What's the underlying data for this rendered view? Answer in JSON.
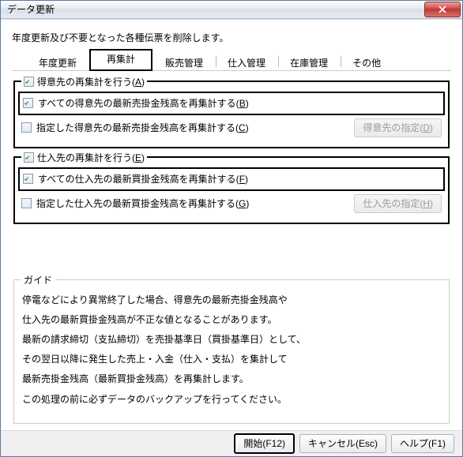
{
  "window": {
    "title": "データ更新"
  },
  "intro": "年度更新及び不要となった各種伝票を削除します。",
  "tabs": {
    "t0": "年度更新",
    "t1": "再集計",
    "t2": "販売管理",
    "t3": "仕入管理",
    "t4": "在庫管理",
    "t5": "その他"
  },
  "grp1": {
    "legend_pre": "得意先の再集計を行う(",
    "legend_u": "A",
    "legend_post": ")",
    "r1_pre": "すべての得意先の最新売掛金残高を再集計する(",
    "r1_u": "B",
    "r1_post": ")",
    "r2_pre": "指定した得意先の最新売掛金残高を再集計する(",
    "r2_u": "C",
    "r2_post": ")",
    "btn_pre": "得意先の指定(",
    "btn_u": "D",
    "btn_post": ")"
  },
  "grp2": {
    "legend_pre": "仕入先の再集計を行う(",
    "legend_u": "E",
    "legend_post": ")",
    "r1_pre": "すべての仕入先の最新買掛金残高を再集計する(",
    "r1_u": "F",
    "r1_post": ")",
    "r2_pre": "指定した仕入先の最新買掛金残高を再集計する(",
    "r2_u": "G",
    "r2_post": ")",
    "btn_pre": "仕入先の指定(",
    "btn_u": "H",
    "btn_post": ")"
  },
  "guide": {
    "title": "ガイド",
    "l1": "停電などにより異常終了した場合、得意先の最新売掛金残高や",
    "l2": "仕入先の最新買掛金残高が不正な値となることがあります。",
    "l3": "最新の請求締切（支払締切）を売掛基準日（買掛基準日）として、",
    "l4": "その翌日以降に発生した売上・入金（仕入・支払）を集計して",
    "l5": "最新売掛金残高（最新買掛金残高）を再集計します。",
    "l6": "この処理の前に必ずデータのバックアップを行ってください。"
  },
  "footer": {
    "start": "開始(F12)",
    "cancel": "キャンセル(Esc)",
    "help": "ヘルプ(F1)"
  }
}
